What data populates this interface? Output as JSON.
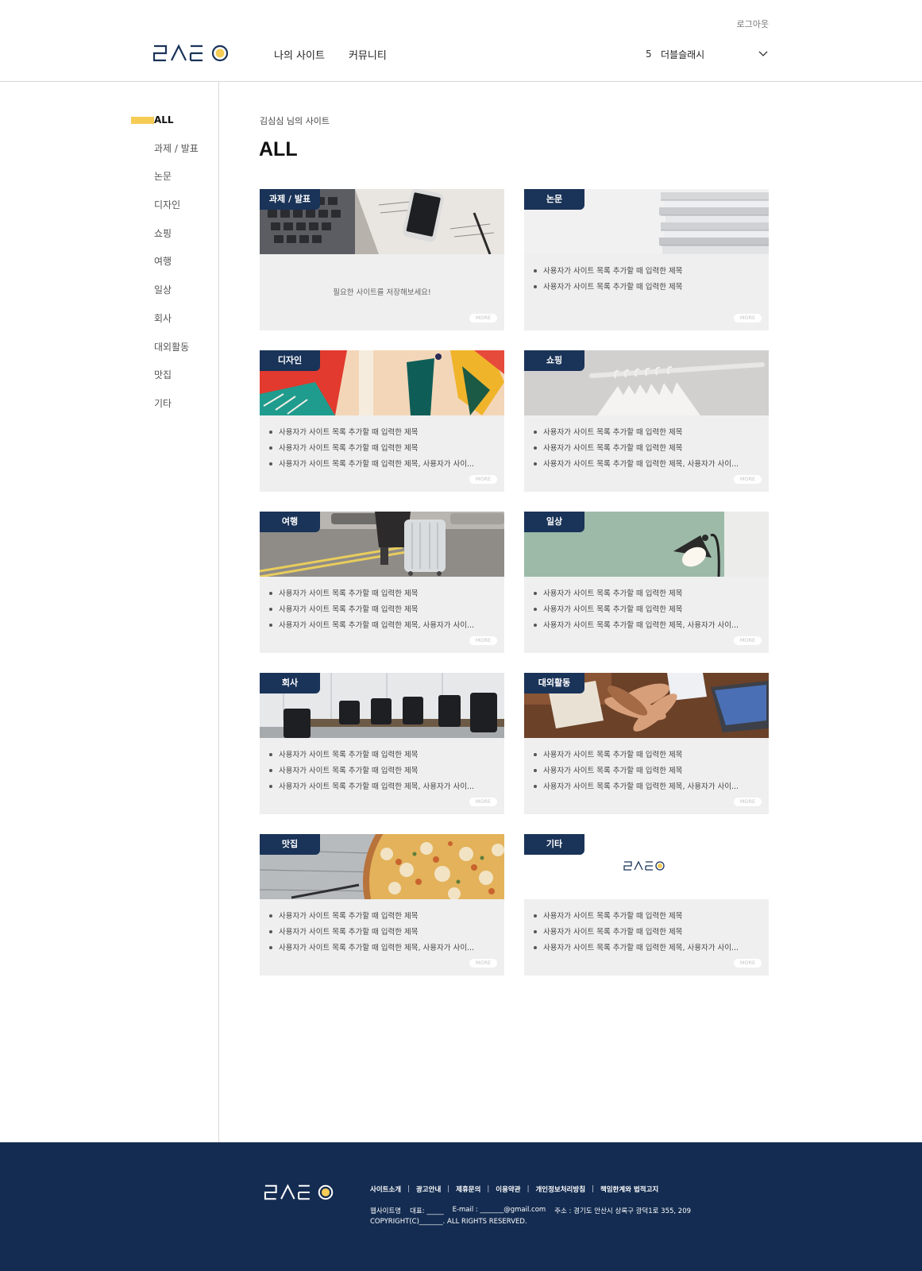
{
  "header": {
    "logout": "로그아웃",
    "nav": [
      "나의 사이트",
      "커뮤니티"
    ],
    "user": {
      "count": "5",
      "name": "더블슬래시"
    }
  },
  "sidebar": {
    "items": [
      "ALL",
      "과제 / 발표",
      "논문",
      "디자인",
      "쇼핑",
      "여행",
      "일상",
      "회사",
      "대외활동",
      "맛집",
      "기타"
    ],
    "active": "ALL"
  },
  "main": {
    "breadcrumb": "김심심 님의 사이트",
    "title": "ALL",
    "more_label": "MORE",
    "cards": [
      {
        "tag": "과제 / 발표",
        "empty": "필요한 사이트를 저장해보세요!",
        "items": []
      },
      {
        "tag": "논문",
        "items": [
          "사용자가 사이트 목록 추가할 때 입력한 제목",
          "사용자가 사이트 목록 추가할 때 입력한 제목"
        ]
      },
      {
        "tag": "디자인",
        "items": [
          "사용자가 사이트 목록 추가할 때 입력한 제목",
          "사용자가 사이트 목록 추가할 때 입력한 제목",
          "사용자가 사이트 목록 추가할 때 입력한 제목, 사용자가 사이..."
        ]
      },
      {
        "tag": "쇼핑",
        "items": [
          "사용자가 사이트 목록 추가할 때 입력한 제목",
          "사용자가 사이트 목록 추가할 때 입력한 제목",
          "사용자가 사이트 목록 추가할 때 입력한 제목, 사용자가 사이..."
        ]
      },
      {
        "tag": "여행",
        "items": [
          "사용자가 사이트 목록 추가할 때 입력한 제목",
          "사용자가 사이트 목록 추가할 때 입력한 제목",
          "사용자가 사이트 목록 추가할 때 입력한 제목, 사용자가 사이..."
        ]
      },
      {
        "tag": "일상",
        "items": [
          "사용자가 사이트 목록 추가할 때 입력한 제목",
          "사용자가 사이트 목록 추가할 때 입력한 제목",
          "사용자가 사이트 목록 추가할 때 입력한 제목, 사용자가 사이..."
        ]
      },
      {
        "tag": "회사",
        "items": [
          "사용자가 사이트 목록 추가할 때 입력한 제목",
          "사용자가 사이트 목록 추가할 때 입력한 제목",
          "사용자가 사이트 목록 추가할 때 입력한 제목, 사용자가 사이..."
        ]
      },
      {
        "tag": "대외활동",
        "items": [
          "사용자가 사이트 목록 추가할 때 입력한 제목",
          "사용자가 사이트 목록 추가할 때 입력한 제목",
          "사용자가 사이트 목록 추가할 때 입력한 제목, 사용자가 사이..."
        ]
      },
      {
        "tag": "맛집",
        "items": [
          "사용자가 사이트 목록 추가할 때 입력한 제목",
          "사용자가 사이트 목록 추가할 때 입력한 제목",
          "사용자가 사이트 목록 추가할 때 입력한 제목, 사용자가 사이..."
        ]
      },
      {
        "tag": "기타",
        "items": [
          "사용자가 사이트 목록 추가할 때 입력한 제목",
          "사용자가 사이트 목록 추가할 때 입력한 제목",
          "사용자가 사이트 목록 추가할 때 입력한 제목, 사용자가 사이..."
        ]
      }
    ]
  },
  "footer": {
    "links": [
      "사이트소개",
      "광고안내",
      "제휴문의",
      "이용약관",
      "개인정보처리방침",
      "책임한계와 법적고지"
    ],
    "info": [
      "웹사이트명",
      "대표: _____",
      "E-mail : _______@gmail.com",
      "주소 : 경기도 안산시 상록구 광덕1로 355, 209"
    ],
    "copyright": "COPYRIGHT(C)_______. ALL RIGHTS RESERVED."
  },
  "colors": {
    "navy": "#1a3358",
    "footer_bg": "#142c51",
    "accent_yellow": "#f6cc55",
    "card_bg": "#efefef"
  },
  "icons": {
    "dropdown": "chevron-down-icon",
    "logo": "brand-logo"
  }
}
